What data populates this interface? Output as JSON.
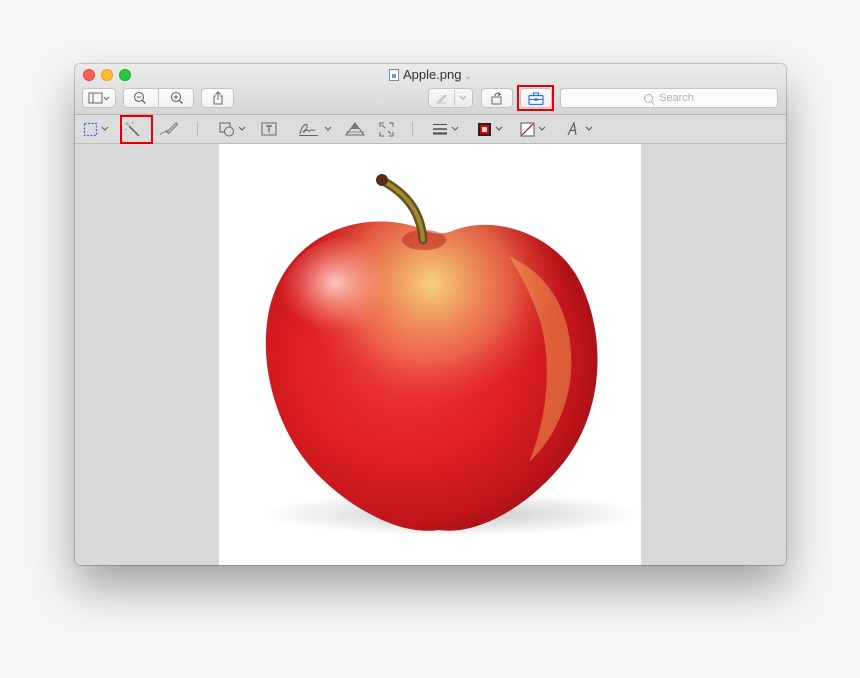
{
  "window": {
    "title": "Apple.png"
  },
  "toolbar": {
    "search_placeholder": "Search"
  },
  "image": {
    "subject": "red apple"
  },
  "colors": {
    "highlight": "#e00000",
    "toolbox_icon": "#2b6ee6"
  }
}
